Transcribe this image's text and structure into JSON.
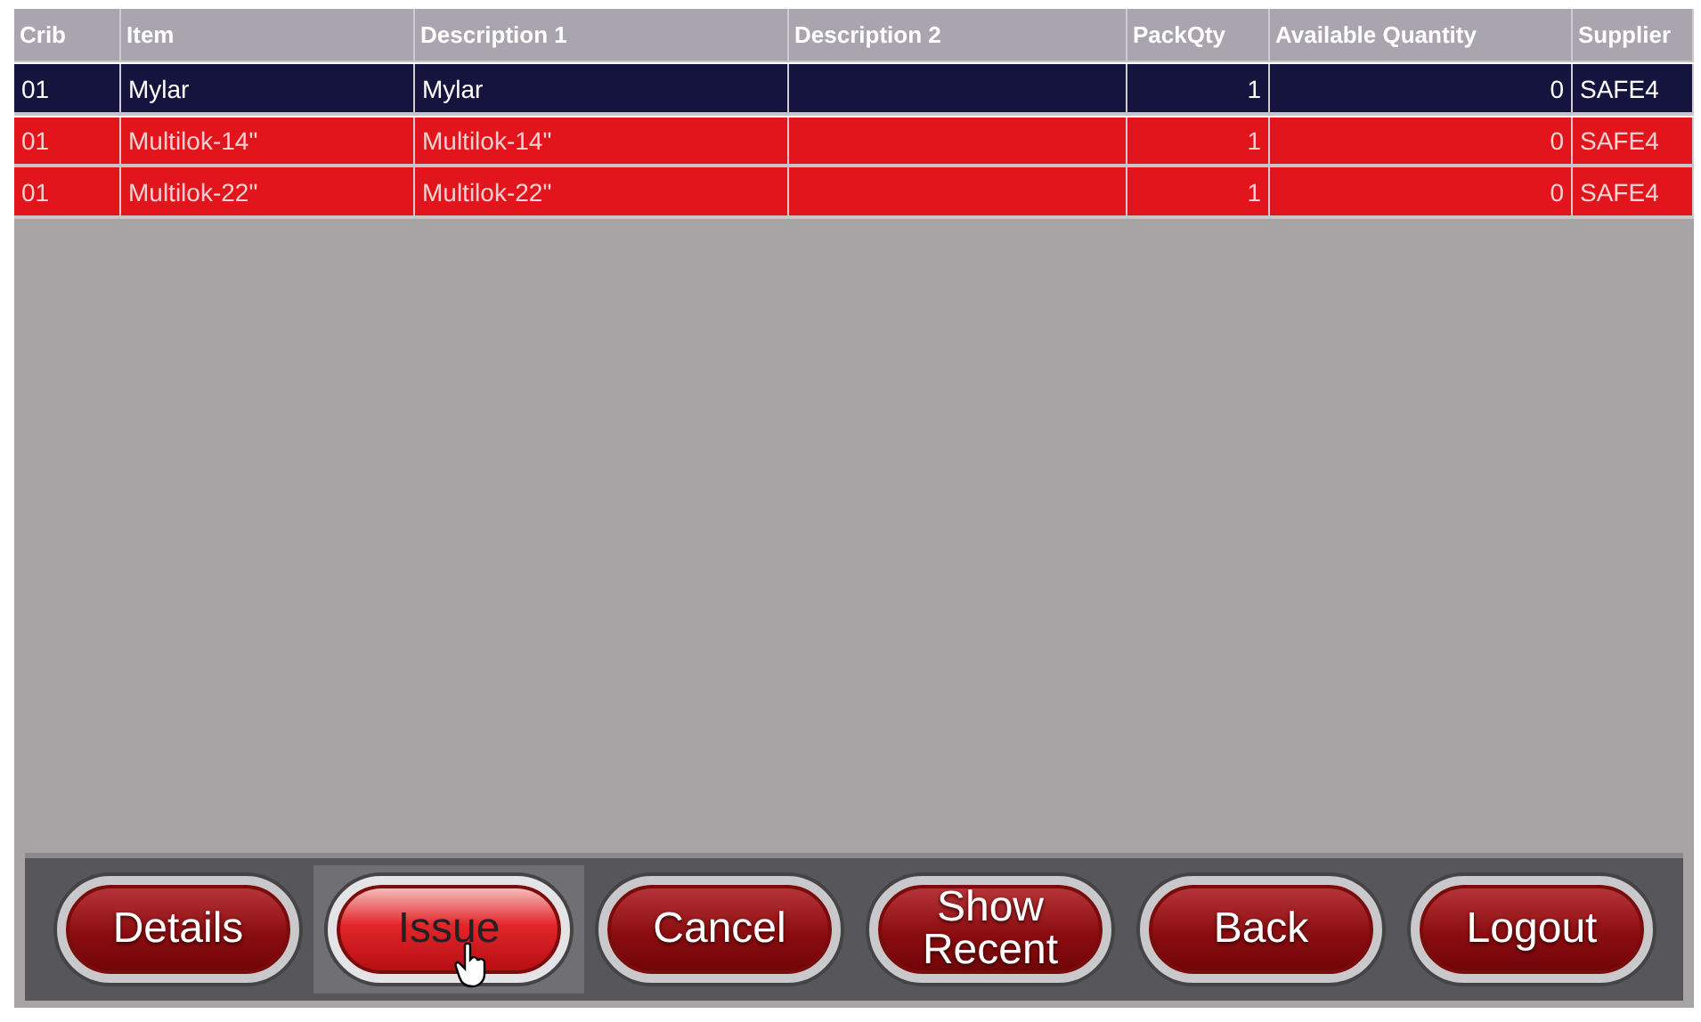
{
  "table": {
    "columns": [
      "Crib",
      "Item",
      "Description 1",
      "Description 2",
      "PackQty",
      "Available Quantity",
      "Supplier"
    ],
    "rows": [
      {
        "selected": true,
        "color": "#14143f",
        "cells": [
          "01",
          "Mylar",
          "Mylar",
          "",
          "1",
          "0",
          "SAFE4"
        ]
      },
      {
        "selected": false,
        "color": "#e2141c",
        "cells": [
          "01",
          "Multilok-14\"",
          "Multilok-14\"",
          "",
          "1",
          "0",
          "SAFE4"
        ]
      },
      {
        "selected": false,
        "color": "#e2141c",
        "cells": [
          "01",
          "Multilok-22\"",
          "Multilok-22\"",
          "",
          "1",
          "0",
          "SAFE4"
        ]
      }
    ]
  },
  "buttons": [
    {
      "label": "Details",
      "selected": false
    },
    {
      "label": "Issue",
      "selected": true
    },
    {
      "label": "Cancel",
      "selected": false
    },
    {
      "label": "Show Recent",
      "selected": false
    },
    {
      "label": "Back",
      "selected": false
    },
    {
      "label": "Logout",
      "selected": false
    }
  ]
}
